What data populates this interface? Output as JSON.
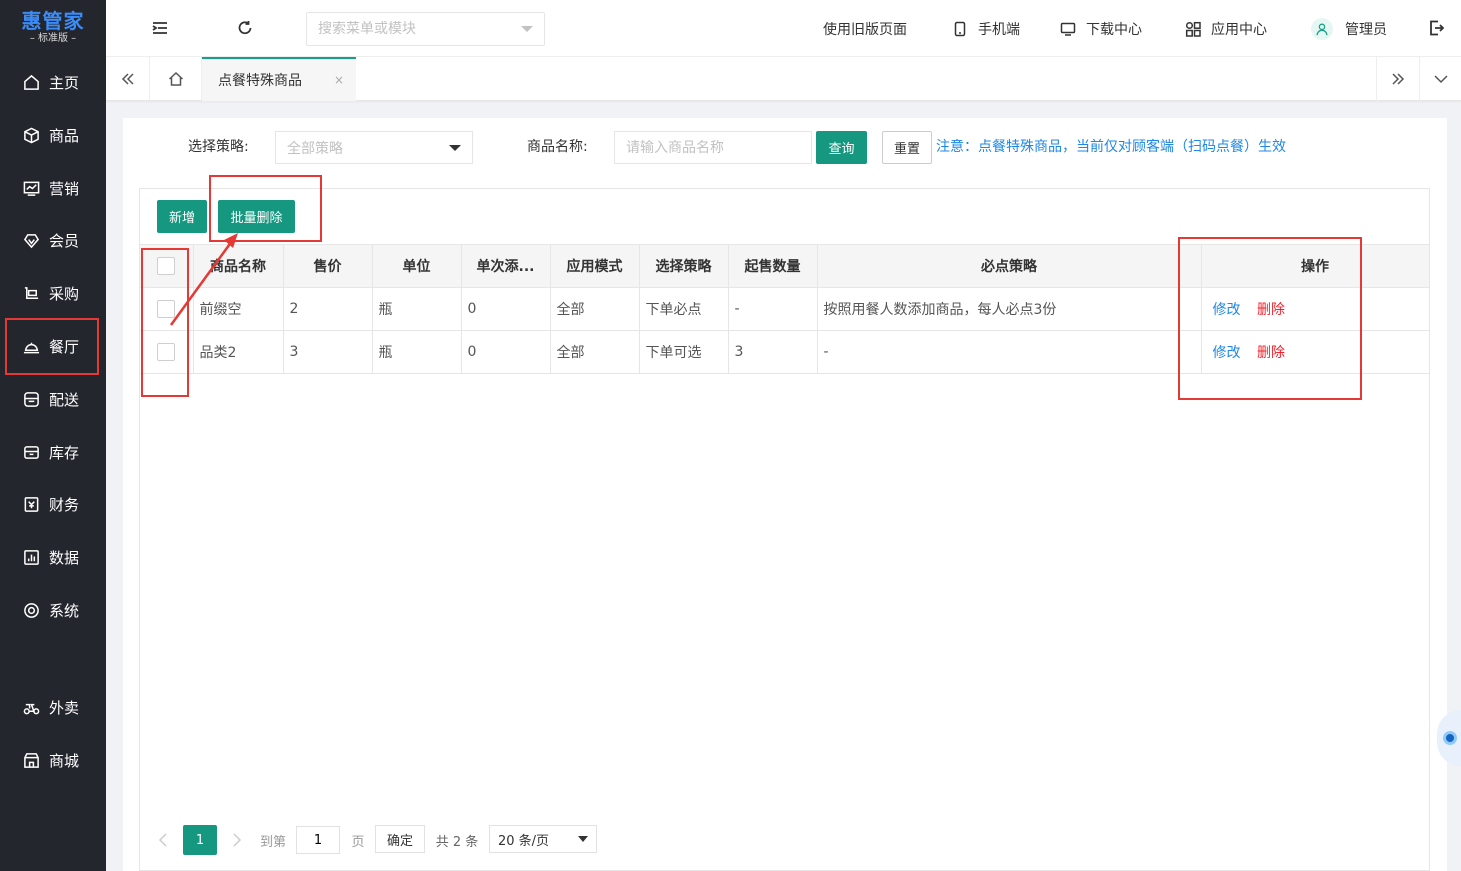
{
  "app": {
    "logo_title": "惠管家",
    "logo_sub": "– 标准版 –"
  },
  "sidebar": {
    "items": [
      {
        "label": "主页",
        "icon": "home-icon"
      },
      {
        "label": "商品",
        "icon": "box-icon"
      },
      {
        "label": "营销",
        "icon": "chart-icon"
      },
      {
        "label": "会员",
        "icon": "diamond-icon"
      },
      {
        "label": "采购",
        "icon": "purchase-icon"
      },
      {
        "label": "餐厅",
        "icon": "dining-icon",
        "active": true
      },
      {
        "label": "配送",
        "icon": "delivery-icon"
      },
      {
        "label": "库存",
        "icon": "inventory-icon"
      },
      {
        "label": "财务",
        "icon": "finance-icon"
      },
      {
        "label": "数据",
        "icon": "data-icon"
      },
      {
        "label": "系统",
        "icon": "system-icon"
      },
      {
        "label": "外卖",
        "icon": "takeout-icon"
      },
      {
        "label": "商城",
        "icon": "store-icon"
      }
    ]
  },
  "header": {
    "search_placeholder": "搜索菜单或模块",
    "old_page": "使用旧版页面",
    "mobile": "手机端",
    "download": "下载中心",
    "apps": "应用中心",
    "user": "管理员"
  },
  "tabs": {
    "active_label": "点餐特殊商品",
    "close": "×"
  },
  "filters": {
    "strategy_label": "选择策略:",
    "strategy_value": "全部策略",
    "name_label": "商品名称:",
    "name_placeholder": "请输入商品名称",
    "query": "查询",
    "reset": "重置",
    "notice": "注意：点餐特殊商品，当前仅对顾客端（扫码点餐）生效"
  },
  "toolbar": {
    "add": "新增",
    "batch_delete": "批量删除"
  },
  "table": {
    "columns": [
      "商品名称",
      "售价",
      "单位",
      "单次添...",
      "应用模式",
      "选择策略",
      "起售数量",
      "必点策略",
      "操作"
    ],
    "rows": [
      {
        "name": "前缀空",
        "price": "2",
        "unit": "瓶",
        "single_add": "0",
        "mode": "全部",
        "strategy": "下单必点",
        "min_qty": "-",
        "must_strategy": "按照用餐人数添加商品，每人必点3份",
        "edit": "修改",
        "delete": "删除"
      },
      {
        "name": "品类2",
        "price": "3",
        "unit": "瓶",
        "single_add": "0",
        "mode": "全部",
        "strategy": "下单可选",
        "min_qty": "3",
        "must_strategy": "-",
        "edit": "修改",
        "delete": "删除"
      }
    ]
  },
  "pagination": {
    "current": "1",
    "goto_label": "到第",
    "goto_value": "1",
    "page_unit": "页",
    "confirm": "确定",
    "total": "共 2 条",
    "page_size": "20 条/页"
  },
  "colors": {
    "primary": "#16977f",
    "sidebar_bg": "#24262e",
    "link": "#1e88e5",
    "danger": "#f5222d",
    "annotation": "#e53935"
  }
}
